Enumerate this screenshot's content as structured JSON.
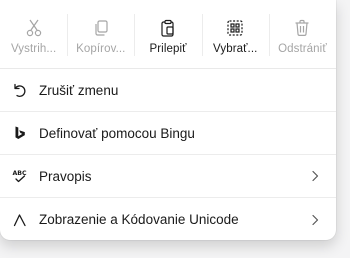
{
  "toolbar": {
    "buttons": [
      {
        "label": "Vystrih...",
        "icon": "cut-icon",
        "enabled": false
      },
      {
        "label": "Kopírov...",
        "icon": "copy-icon",
        "enabled": false
      },
      {
        "label": "Prilepiť",
        "icon": "paste-icon",
        "enabled": true
      },
      {
        "label": "Vybrať...",
        "icon": "select-all-icon",
        "enabled": true
      },
      {
        "label": "Odstrániť",
        "icon": "delete-icon",
        "enabled": false
      }
    ]
  },
  "menu": {
    "items": [
      {
        "label": "Zrušiť zmenu",
        "icon": "undo-icon",
        "has_submenu": false
      },
      {
        "label": "Definovať pomocou Bingu",
        "icon": "bing-icon",
        "has_submenu": false
      },
      {
        "label": "Pravopis",
        "icon": "spellcheck-icon",
        "has_submenu": true
      },
      {
        "label": "Zobrazenie a Kódovanie Unicode",
        "icon": "unicode-icon",
        "has_submenu": true
      }
    ]
  },
  "colors": {
    "text": "#1a1a1a",
    "disabled_text": "#a5a5a5",
    "background": "#ffffff",
    "separator": "#ececec"
  }
}
